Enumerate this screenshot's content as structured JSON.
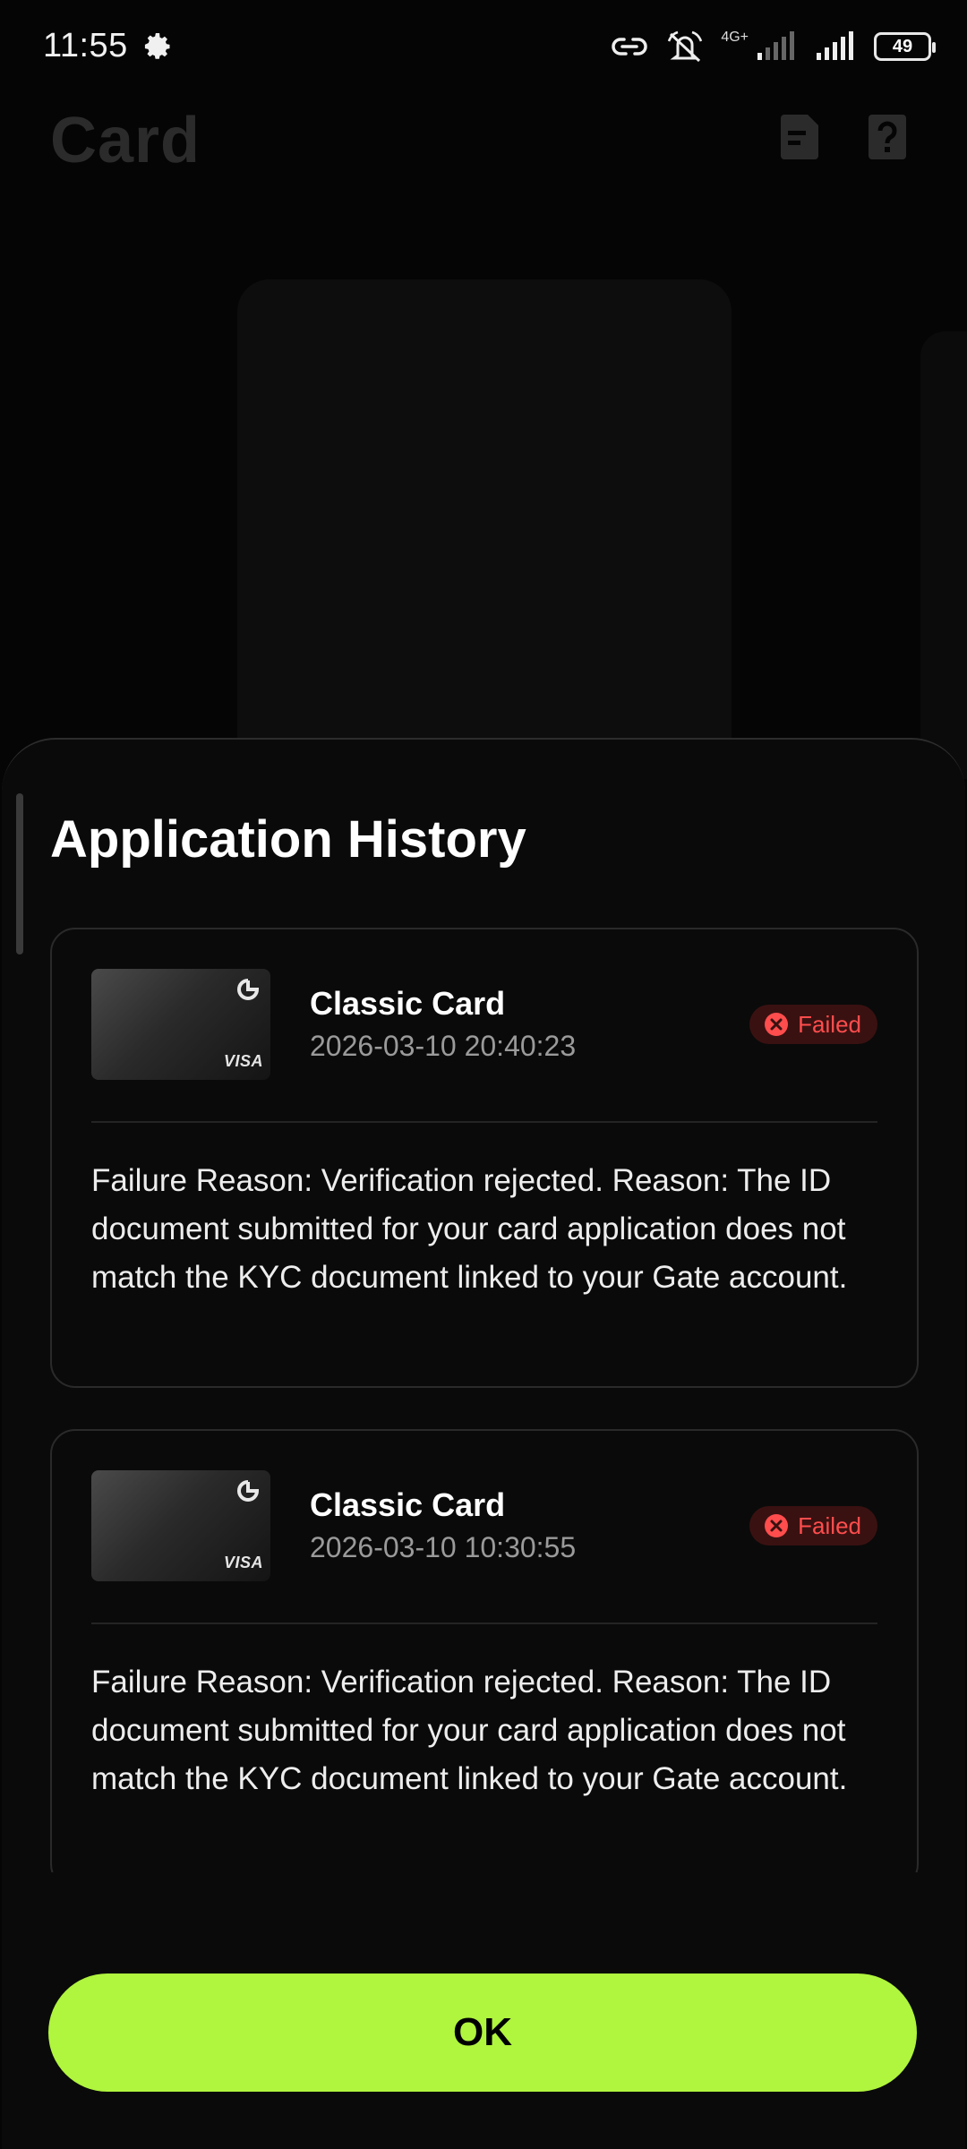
{
  "status_bar": {
    "time": "11:55",
    "network_label": "4G+",
    "battery": "49",
    "icons": [
      "gear-icon",
      "link-icon",
      "mute-icon",
      "signal-icon",
      "signal-icon",
      "battery-icon"
    ]
  },
  "page": {
    "title": "Card",
    "header_icons": [
      "document-icon",
      "help-icon"
    ]
  },
  "sheet": {
    "title": "Application History",
    "applications": [
      {
        "card_name": "Classic Card",
        "date": "2026-03-10 20:40:23",
        "status": "Failed",
        "thumb_brand": "VISA",
        "reason": "Failure Reason: Verification rejected. Reason: The ID document submitted for your card application does not match the KYC document linked to your Gate account."
      },
      {
        "card_name": "Classic Card",
        "date": "2026-03-10 10:30:55",
        "status": "Failed",
        "thumb_brand": "VISA",
        "reason": "Failure Reason: Verification rejected. Reason: The ID document submitted for your card application does not match the KYC document linked to your Gate account."
      }
    ],
    "ok_label": "OK"
  },
  "colors": {
    "accent": "#b0f53e",
    "failed_text": "#ff4d4d",
    "failed_bg": "#3a1111",
    "background": "#0a0a0a"
  }
}
